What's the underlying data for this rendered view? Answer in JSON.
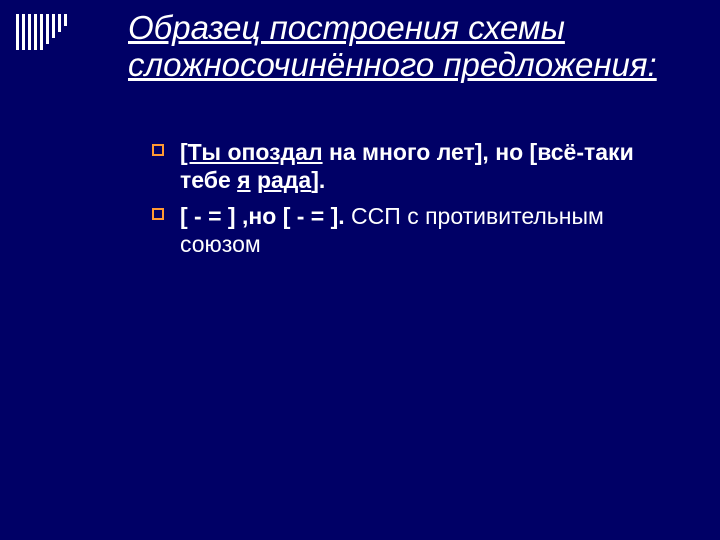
{
  "title": "Образец  построения схемы сложносочинённого предложения:",
  "bullets": [
    {
      "p1": "[Ты опоздал",
      "p2": " на много лет], но [всё-таки тебе ",
      "p3": "я",
      "p4": " ",
      "p5": "рада",
      "p6": "]."
    },
    {
      "p1": "[ - =   ] ,но [ - =   ].",
      "p2": " ССП с противительным союзом"
    }
  ]
}
